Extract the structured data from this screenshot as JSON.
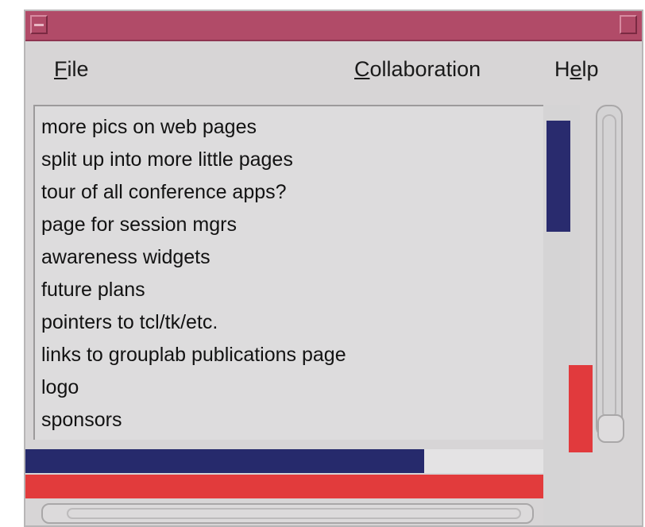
{
  "window": {
    "title": ""
  },
  "menubar": {
    "file": {
      "mnemonic": "F",
      "rest": "ile"
    },
    "collaboration": {
      "mnemonic": "C",
      "rest": "ollaboration"
    },
    "help": {
      "pre": "H",
      "mnemonic": "e",
      "rest": "lp"
    }
  },
  "editor": {
    "lines": [
      "more pics on web pages",
      "split up into more little pages",
      "tour of all conference apps?",
      "page for session mgrs",
      "awareness widgets",
      "future plans",
      "pointers to tcl/tk/etc.",
      "links to grouplab publications page",
      "logo",
      "sponsors"
    ]
  },
  "colors": {
    "participant_blue": "#262a6c",
    "participant_red": "#e23b3c",
    "titlebar": "#b14b68"
  },
  "scroll": {
    "blue_user_horizontal_view_fraction": 0.77,
    "red_user_horizontal_view_fraction": 1.0
  }
}
